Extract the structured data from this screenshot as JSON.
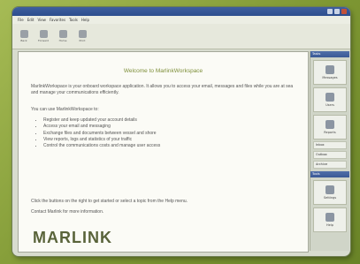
{
  "window": {
    "title": ""
  },
  "menu": [
    "File",
    "Edit",
    "View",
    "Favorites",
    "Tools",
    "Help"
  ],
  "toolbar": [
    {
      "label": "Back",
      "icon": "back-arrow-icon"
    },
    {
      "label": "Forward",
      "icon": "forward-arrow-icon"
    },
    {
      "label": "Home",
      "icon": "home-icon"
    },
    {
      "label": "Print",
      "icon": "print-icon"
    }
  ],
  "document": {
    "title": "Welcome to MarlinkWorkspace",
    "intro": "MarlinkWorkspace is your onboard workspace application. It allows you to access your email, messages and files while you are at sea and manage your communications efficiently.",
    "you_can": "You can use MarlinkWorkspace to:",
    "bullets": [
      "Register and keep updated your account details",
      "Access your email and messaging",
      "Exchange files and documents between vessel and shore",
      "View reports, logs and statistics of your traffic",
      "Control the communications costs and manage user access"
    ],
    "help_line": "Click the buttons on the right to get started or select a topic from the Help menu.",
    "contact_line": "Contact Marlink for more information.",
    "logo_text": "MARLINK"
  },
  "sidepanel": {
    "header": "Tasks",
    "buttons": [
      {
        "label": "Messages",
        "icon": "envelope-icon"
      },
      {
        "label": "Users",
        "icon": "users-icon"
      },
      {
        "label": "Reports",
        "icon": "report-icon"
      }
    ],
    "list_items": [
      "Inbox",
      "Outbox",
      "Archive"
    ],
    "section2": "Tools",
    "buttons2": [
      {
        "label": "Settings",
        "icon": "gear-icon"
      },
      {
        "label": "Help",
        "icon": "help-icon"
      }
    ]
  }
}
